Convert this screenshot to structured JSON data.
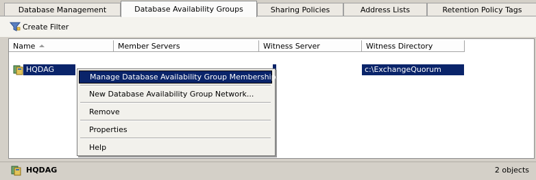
{
  "tabs": [
    {
      "label": "Database Management",
      "active": false
    },
    {
      "label": "Database Availability Groups",
      "active": true
    },
    {
      "label": "Sharing Policies",
      "active": false
    },
    {
      "label": "Address Lists",
      "active": false
    },
    {
      "label": "Retention Policy Tags",
      "active": false
    }
  ],
  "toolbar": {
    "create_filter_label": "Create Filter",
    "icon": "filter-icon"
  },
  "list": {
    "columns": [
      "Name",
      "Member Servers",
      "Witness Server",
      "Witness Directory"
    ],
    "sort_column": "Name",
    "rows": [
      {
        "name": "HQDAG",
        "witness_directory": "c:\\ExchangeQuorum",
        "icon": "dag-icon"
      }
    ]
  },
  "context_menu": {
    "items": [
      {
        "label": "Manage Database Availability Group Membership...",
        "highlighted": true
      },
      {
        "label": "New Database Availability Group Network...",
        "highlighted": false
      },
      {
        "label": "Remove",
        "highlighted": false
      },
      {
        "label": "Properties",
        "highlighted": false
      },
      {
        "label": "Help",
        "highlighted": false
      }
    ]
  },
  "status_bar": {
    "selected_name": "HQDAG",
    "count": "2 objects",
    "icon": "dag-icon"
  },
  "colors": {
    "selection": "#0a246a",
    "window": "#d4d0c8"
  }
}
